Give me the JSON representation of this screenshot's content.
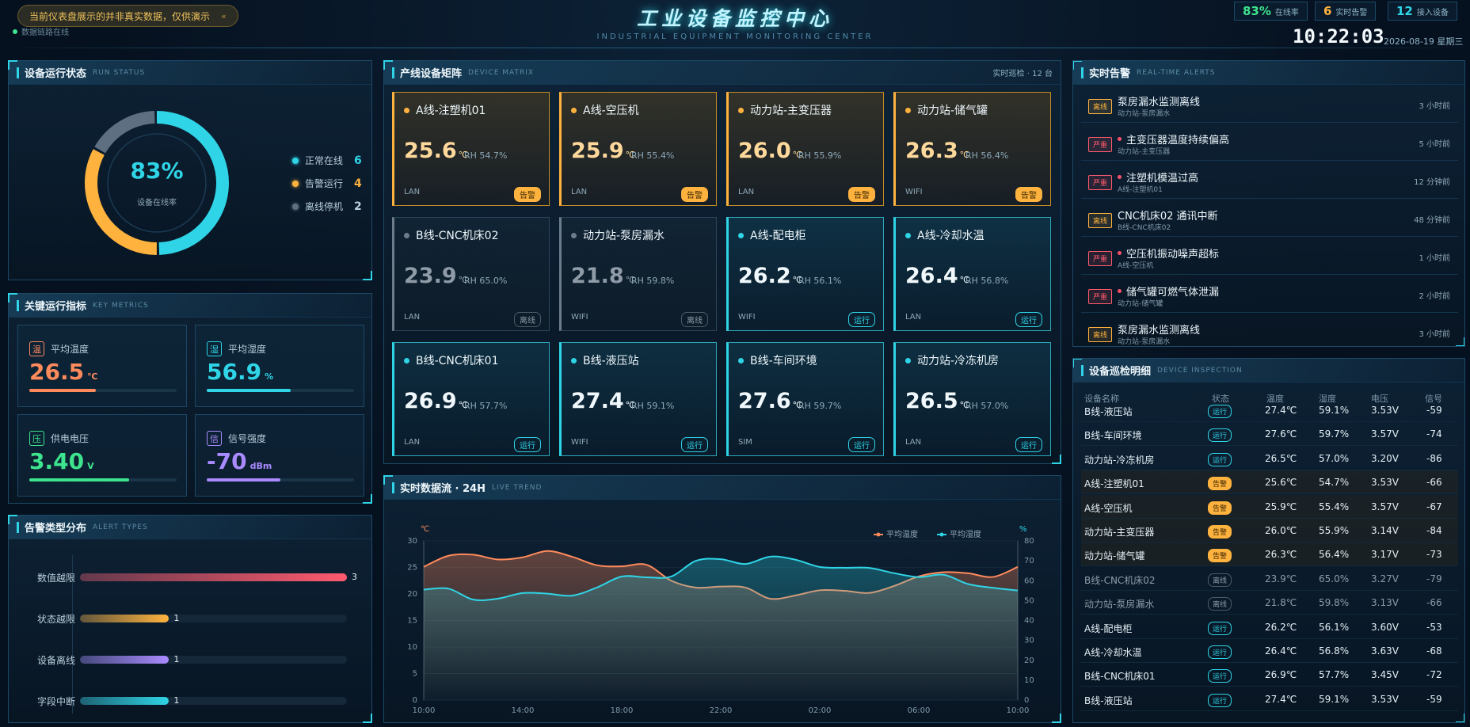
{
  "header": {
    "title": "工业设备监控中心",
    "subtitle": "INDUSTRIAL EQUIPMENT MONITORING CENTER",
    "notice": "当前仪表盘展示的并非真实数据，仅供演示",
    "notice_close": "«",
    "link_status": "数据链路在线",
    "stats": [
      {
        "value": "83%",
        "label": "在线率",
        "color": "#3ee48d"
      },
      {
        "value": "6",
        "label": "实时告警",
        "color": "#ffb33e"
      },
      {
        "value": "12",
        "label": "接入设备",
        "color": "#2fd5e6"
      }
    ],
    "time": "10:22:03",
    "date": "2026-08-19 星期三"
  },
  "run_status": {
    "title": "设备运行状态",
    "title_en": "RUN STATUS",
    "rate": "83%",
    "rate_label": "设备在线率",
    "segments": [
      {
        "label": "正常在线",
        "value": 6,
        "color": "#2fd5e6"
      },
      {
        "label": "告警运行",
        "value": 4,
        "color": "#ffb33e"
      },
      {
        "label": "离线停机",
        "value": 2,
        "color": "#5d6f80"
      }
    ]
  },
  "metrics": {
    "title": "关键运行指标",
    "title_en": "KEY METRICS",
    "cards": [
      {
        "icon": "温",
        "label": "平均温度",
        "value": "26.5",
        "unit": "℃",
        "color": "#ff8a5b",
        "level": 0.45
      },
      {
        "icon": "湿",
        "label": "平均湿度",
        "value": "56.9",
        "unit": "%",
        "color": "#2fd5e6",
        "level": 0.57
      },
      {
        "icon": "压",
        "label": "供电电压",
        "value": "3.40",
        "unit": "V",
        "color": "#3ee48d",
        "level": 0.68
      },
      {
        "icon": "信",
        "label": "信号强度",
        "value": "-70",
        "unit": "dBm",
        "color": "#a98bff",
        "level": 0.5
      }
    ]
  },
  "alert_types": {
    "title": "告警类型分布",
    "title_en": "ALERT TYPES",
    "items": [
      {
        "label": "数值越限",
        "value": 3,
        "color": "#ff5a6e"
      },
      {
        "label": "状态越限",
        "value": 1,
        "color": "#ffb33e"
      },
      {
        "label": "设备离线",
        "value": 1,
        "color": "#a98bff"
      },
      {
        "label": "字段中断",
        "value": 1,
        "color": "#2fd5e6"
      }
    ]
  },
  "matrix": {
    "title": "产线设备矩阵",
    "title_en": "DEVICE MATRIX",
    "right": "实时巡检 · 12 台",
    "devices": [
      {
        "name": "A线-注塑机01",
        "temp": "25.6",
        "rh": "RH 54.7%",
        "net": "LAN",
        "status": "告警",
        "state": "warn"
      },
      {
        "name": "A线-空压机",
        "temp": "25.9",
        "rh": "RH 55.4%",
        "net": "LAN",
        "status": "告警",
        "state": "warn"
      },
      {
        "name": "动力站-主变压器",
        "temp": "26.0",
        "rh": "RH 55.9%",
        "net": "LAN",
        "status": "告警",
        "state": "warn"
      },
      {
        "name": "动力站-储气罐",
        "temp": "26.3",
        "rh": "RH 56.4%",
        "net": "WIFI",
        "status": "告警",
        "state": "warn"
      },
      {
        "name": "B线-CNC机床02",
        "temp": "23.9",
        "rh": "RH 65.0%",
        "net": "LAN",
        "status": "离线",
        "state": "off"
      },
      {
        "name": "动力站-泵房漏水",
        "temp": "21.8",
        "rh": "RH 59.8%",
        "net": "WIFI",
        "status": "离线",
        "state": "off"
      },
      {
        "name": "A线-配电柜",
        "temp": "26.2",
        "rh": "RH 56.1%",
        "net": "WIFI",
        "status": "运行",
        "state": "run"
      },
      {
        "name": "A线-冷却水温",
        "temp": "26.4",
        "rh": "RH 56.8%",
        "net": "LAN",
        "status": "运行",
        "state": "run"
      },
      {
        "name": "B线-CNC机床01",
        "temp": "26.9",
        "rh": "RH 57.7%",
        "net": "LAN",
        "status": "运行",
        "state": "run"
      },
      {
        "name": "B线-液压站",
        "temp": "27.4",
        "rh": "RH 59.1%",
        "net": "WIFI",
        "status": "运行",
        "state": "run"
      },
      {
        "name": "B线-车间环境",
        "temp": "27.6",
        "rh": "RH 59.7%",
        "net": "SIM",
        "status": "运行",
        "state": "run"
      },
      {
        "name": "动力站-冷冻机房",
        "temp": "26.5",
        "rh": "RH 57.0%",
        "net": "LAN",
        "status": "运行",
        "state": "run"
      }
    ]
  },
  "trend": {
    "title": "实时数据流 · 24H",
    "title_en": "LIVE TREND",
    "chart_data": {
      "type": "area",
      "title": "",
      "x": [
        "10:00",
        "11:00",
        "12:00",
        "13:00",
        "14:00",
        "15:00",
        "16:00",
        "17:00",
        "18:00",
        "19:00",
        "20:00",
        "21:00",
        "22:00",
        "23:00",
        "00:00",
        "01:00",
        "02:00",
        "03:00",
        "04:00",
        "05:00",
        "06:00",
        "07:00",
        "08:00",
        "09:00",
        "10:00"
      ],
      "xticks": [
        "10:00",
        "14:00",
        "18:00",
        "22:00",
        "02:00",
        "06:00",
        "10:00"
      ],
      "ylabel_left": "℃",
      "ylabel_right": "%",
      "ylim_left": [
        0,
        30
      ],
      "ylim_right": [
        0,
        80
      ],
      "yticks_left": [
        0,
        5,
        10,
        15,
        20,
        25,
        30
      ],
      "yticks_right": [
        0,
        10,
        20,
        30,
        40,
        50,
        60,
        70,
        80
      ],
      "legend_position": "top-right",
      "series": [
        {
          "name": "平均温度",
          "axis": "left",
          "color": "#ff8a5b",
          "values": [
            25.1,
            27.2,
            27.4,
            26.5,
            26.9,
            28.1,
            27.0,
            25.4,
            25.2,
            25.5,
            22.5,
            21.2,
            21.4,
            21.2,
            19.1,
            19.7,
            20.7,
            20.6,
            20.2,
            21.5,
            23.3,
            24.1,
            23.9,
            23.2,
            25.1
          ]
        },
        {
          "name": "平均湿度",
          "axis": "right",
          "color": "#2fd5e6",
          "values": [
            55.5,
            56.0,
            50.5,
            51.0,
            53.8,
            53.5,
            52.5,
            56.6,
            62.1,
            61.7,
            62.1,
            70.0,
            70.8,
            68.4,
            72.1,
            70.6,
            66.9,
            66.5,
            66.4,
            63.8,
            61.8,
            63.0,
            58.3,
            56.4,
            55.1
          ]
        }
      ]
    }
  },
  "alerts": {
    "title": "实时告警",
    "title_en": "REAL-TIME ALERTS",
    "items": [
      {
        "level": "离线",
        "kind": "off",
        "title": "泵房漏水监测离线",
        "source": "动力站-泵房漏水",
        "time": "3 小时前",
        "dot": false
      },
      {
        "level": "严重",
        "kind": "crit",
        "title": "主变压器温度持续偏高",
        "source": "动力站-主变压器",
        "time": "5 小时前",
        "dot": true
      },
      {
        "level": "严重",
        "kind": "crit",
        "title": "注塑机模温过高",
        "source": "A线-注塑机01",
        "time": "12 分钟前",
        "dot": true
      },
      {
        "level": "离线",
        "kind": "off",
        "title": "CNC机床02 通讯中断",
        "source": "B线-CNC机床02",
        "time": "48 分钟前",
        "dot": false
      },
      {
        "level": "严重",
        "kind": "crit",
        "title": "空压机振动噪声超标",
        "source": "A线-空压机",
        "time": "1 小时前",
        "dot": true
      },
      {
        "level": "严重",
        "kind": "crit",
        "title": "储气罐可燃气体泄漏",
        "source": "动力站-储气罐",
        "time": "2 小时前",
        "dot": true
      },
      {
        "level": "离线",
        "kind": "off",
        "title": "泵房漏水监测离线",
        "source": "动力站-泵房漏水",
        "time": "3 小时前",
        "dot": false
      }
    ]
  },
  "inspection": {
    "title": "设备巡检明细",
    "title_en": "DEVICE INSPECTION",
    "columns": [
      "设备名称",
      "状态",
      "温度",
      "湿度",
      "电压",
      "信号"
    ],
    "rows": [
      {
        "name": "B线-液压站",
        "status": "运行",
        "kind": "run",
        "temp": "27.4℃",
        "hum": "59.1%",
        "volt": "3.53V",
        "sig": "-59"
      },
      {
        "name": "B线-车间环境",
        "status": "运行",
        "kind": "run",
        "temp": "27.6℃",
        "hum": "59.7%",
        "volt": "3.57V",
        "sig": "-74"
      },
      {
        "name": "动力站-冷冻机房",
        "status": "运行",
        "kind": "run",
        "temp": "26.5℃",
        "hum": "57.0%",
        "volt": "3.20V",
        "sig": "-86"
      },
      {
        "name": "A线-注塑机01",
        "status": "告警",
        "kind": "warn",
        "temp": "25.6℃",
        "hum": "54.7%",
        "volt": "3.53V",
        "sig": "-66"
      },
      {
        "name": "A线-空压机",
        "status": "告警",
        "kind": "warn",
        "temp": "25.9℃",
        "hum": "55.4%",
        "volt": "3.57V",
        "sig": "-67"
      },
      {
        "name": "动力站-主变压器",
        "status": "告警",
        "kind": "warn",
        "temp": "26.0℃",
        "hum": "55.9%",
        "volt": "3.14V",
        "sig": "-84"
      },
      {
        "name": "动力站-储气罐",
        "status": "告警",
        "kind": "warn",
        "temp": "26.3℃",
        "hum": "56.4%",
        "volt": "3.17V",
        "sig": "-73"
      },
      {
        "name": "B线-CNC机床02",
        "status": "离线",
        "kind": "off",
        "temp": "23.9℃",
        "hum": "65.0%",
        "volt": "3.27V",
        "sig": "-79"
      },
      {
        "name": "动力站-泵房漏水",
        "status": "离线",
        "kind": "off",
        "temp": "21.8℃",
        "hum": "59.8%",
        "volt": "3.13V",
        "sig": "-66"
      },
      {
        "name": "A线-配电柜",
        "status": "运行",
        "kind": "run",
        "temp": "26.2℃",
        "hum": "56.1%",
        "volt": "3.60V",
        "sig": "-53"
      },
      {
        "name": "A线-冷却水温",
        "status": "运行",
        "kind": "run",
        "temp": "26.4℃",
        "hum": "56.8%",
        "volt": "3.63V",
        "sig": "-68"
      },
      {
        "name": "B线-CNC机床01",
        "status": "运行",
        "kind": "run",
        "temp": "26.9℃",
        "hum": "57.7%",
        "volt": "3.45V",
        "sig": "-72"
      },
      {
        "name": "B线-液压站",
        "status": "运行",
        "kind": "run",
        "temp": "27.4℃",
        "hum": "59.1%",
        "volt": "3.53V",
        "sig": "-59"
      }
    ]
  }
}
